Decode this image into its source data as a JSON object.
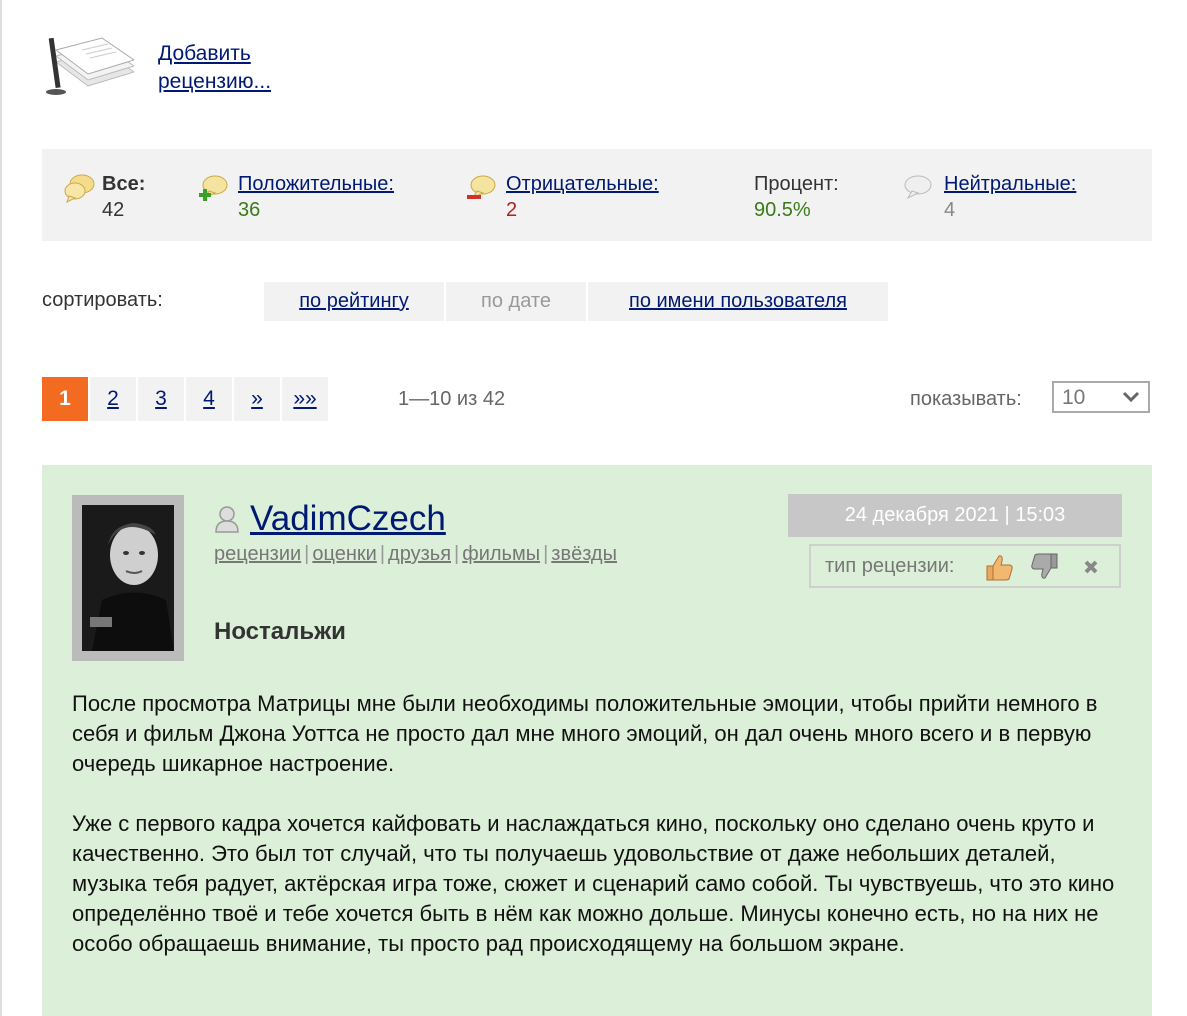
{
  "add_review": {
    "label": "Добавить рецензию..."
  },
  "stats": {
    "all": {
      "label": "Все:",
      "value": "42"
    },
    "positive": {
      "label": "Положительные:",
      "value": "36"
    },
    "negative": {
      "label": "Отрицательные:",
      "value": "2"
    },
    "percent": {
      "label": "Процент:",
      "value": "90.5%"
    },
    "neutral": {
      "label": "Нейтральные:",
      "value": "4"
    }
  },
  "sort": {
    "label": "сортировать:",
    "options": [
      "по рейтингу",
      "по дате",
      "по имени пользователя"
    ]
  },
  "pager": {
    "pages": [
      "1",
      "2",
      "3",
      "4",
      "»",
      "»»"
    ],
    "range": "1—10 из 42",
    "show_label": "показывать:",
    "show_value": "10"
  },
  "review": {
    "username": "VadimCzech",
    "links": [
      "рецензии",
      "оценки",
      "друзья",
      "фильмы",
      "звёзды"
    ],
    "date": "24 декабря 2021 | 15:03",
    "type_label": "тип рецензии:",
    "title": "Ностальжи",
    "paragraphs": [
      "После просмотра Матрицы мне были необходимы положительные эмоции, чтобы прийти немного в себя и фильм Джона Уоттса не просто дал мне много эмоций, он дал очень много всего и в первую очередь шикарное настроение.",
      "Уже с первого кадра хочется кайфовать и наслаждаться кино, поскольку оно сделано очень круто и качественно. Это был тот случай, что ты получаешь удовольствие от даже небольших деталей, музыка тебя радует, актёрская игра тоже, сюжет и сценарий само собой. Ты чувствуешь, что это кино определённо твоё и тебе хочется быть в нём как можно дольше. Минусы конечно есть, но на них не особо обращаешь внимание, ты просто рад происходящему на большом экране."
    ]
  },
  "colors": {
    "accent": "#f26b21",
    "link": "#001a73",
    "positive": "#3a7a1a",
    "negative": "#b31e1e",
    "review_bg": "#dcefd8"
  }
}
